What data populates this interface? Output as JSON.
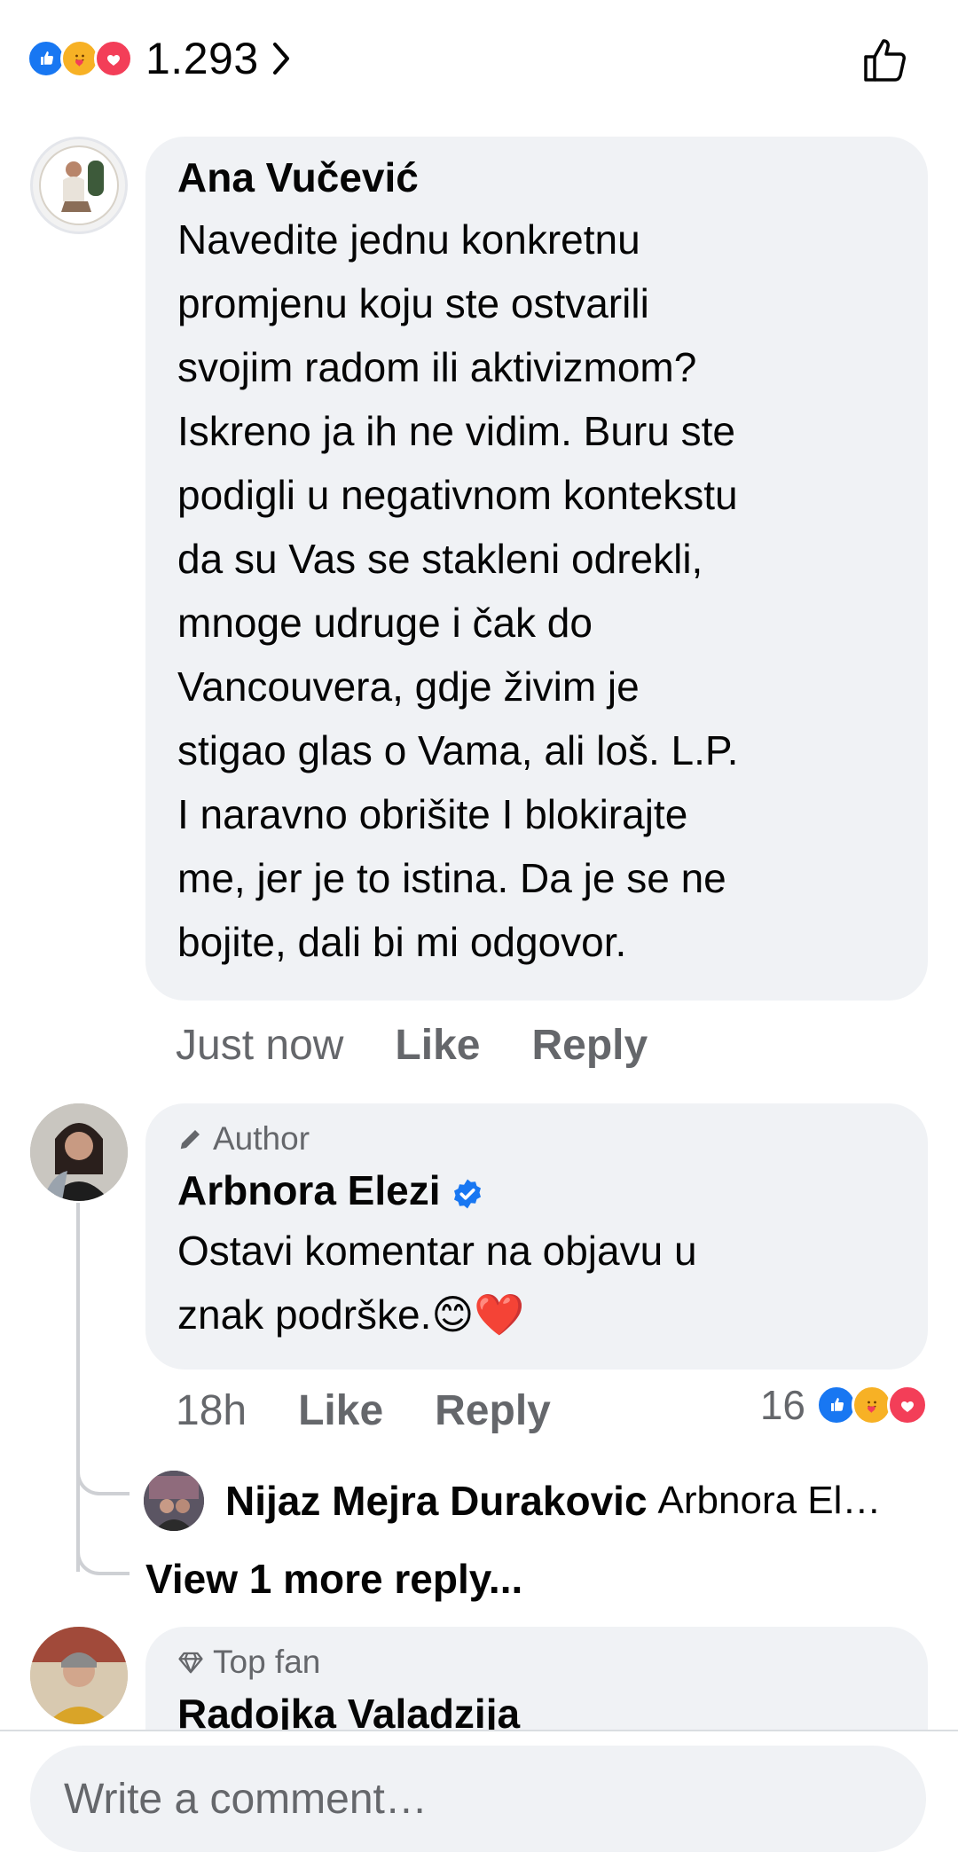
{
  "reactions": {
    "count": "1.293",
    "types": [
      "like-icon",
      "care-icon",
      "love-icon"
    ]
  },
  "comments": [
    {
      "author": "Ana Vučević",
      "text": "Navedite jednu konkretnu\npromjenu koju ste ostvarili\nsvojim radom ili aktivizmom?\nIskreno ja ih ne vidim. Buru ste\npodigli u negativnom kontekstu\nda su Vas se stakleni odrekli,\nmnoge udruge i čak do\nVancouvera, gdje živim je\nstigao glas o Vama, ali loš. L.P.\nI naravno obrišite I blokirajte\nme, jer je to istina. Da je se ne\nbojite, dali bi mi odgovor.",
      "time": "Just now",
      "like": "Like",
      "reply": "Reply"
    },
    {
      "badge": "Author",
      "author": "Arbnora Elezi",
      "text": "Ostavi komentar na objavu u\nznak podrške.😊❤️",
      "time": "18h",
      "like": "Like",
      "reply": "Reply",
      "reaction_count": "16",
      "replies": [
        {
          "author": "Nijaz Mejra Durakovic",
          "preview": "Arbnora El…"
        }
      ],
      "view_more": "View 1 more reply..."
    },
    {
      "badge": "Top fan",
      "author": "Radojka Valadzija"
    }
  ],
  "compose": {
    "placeholder": "Write a comment…"
  }
}
